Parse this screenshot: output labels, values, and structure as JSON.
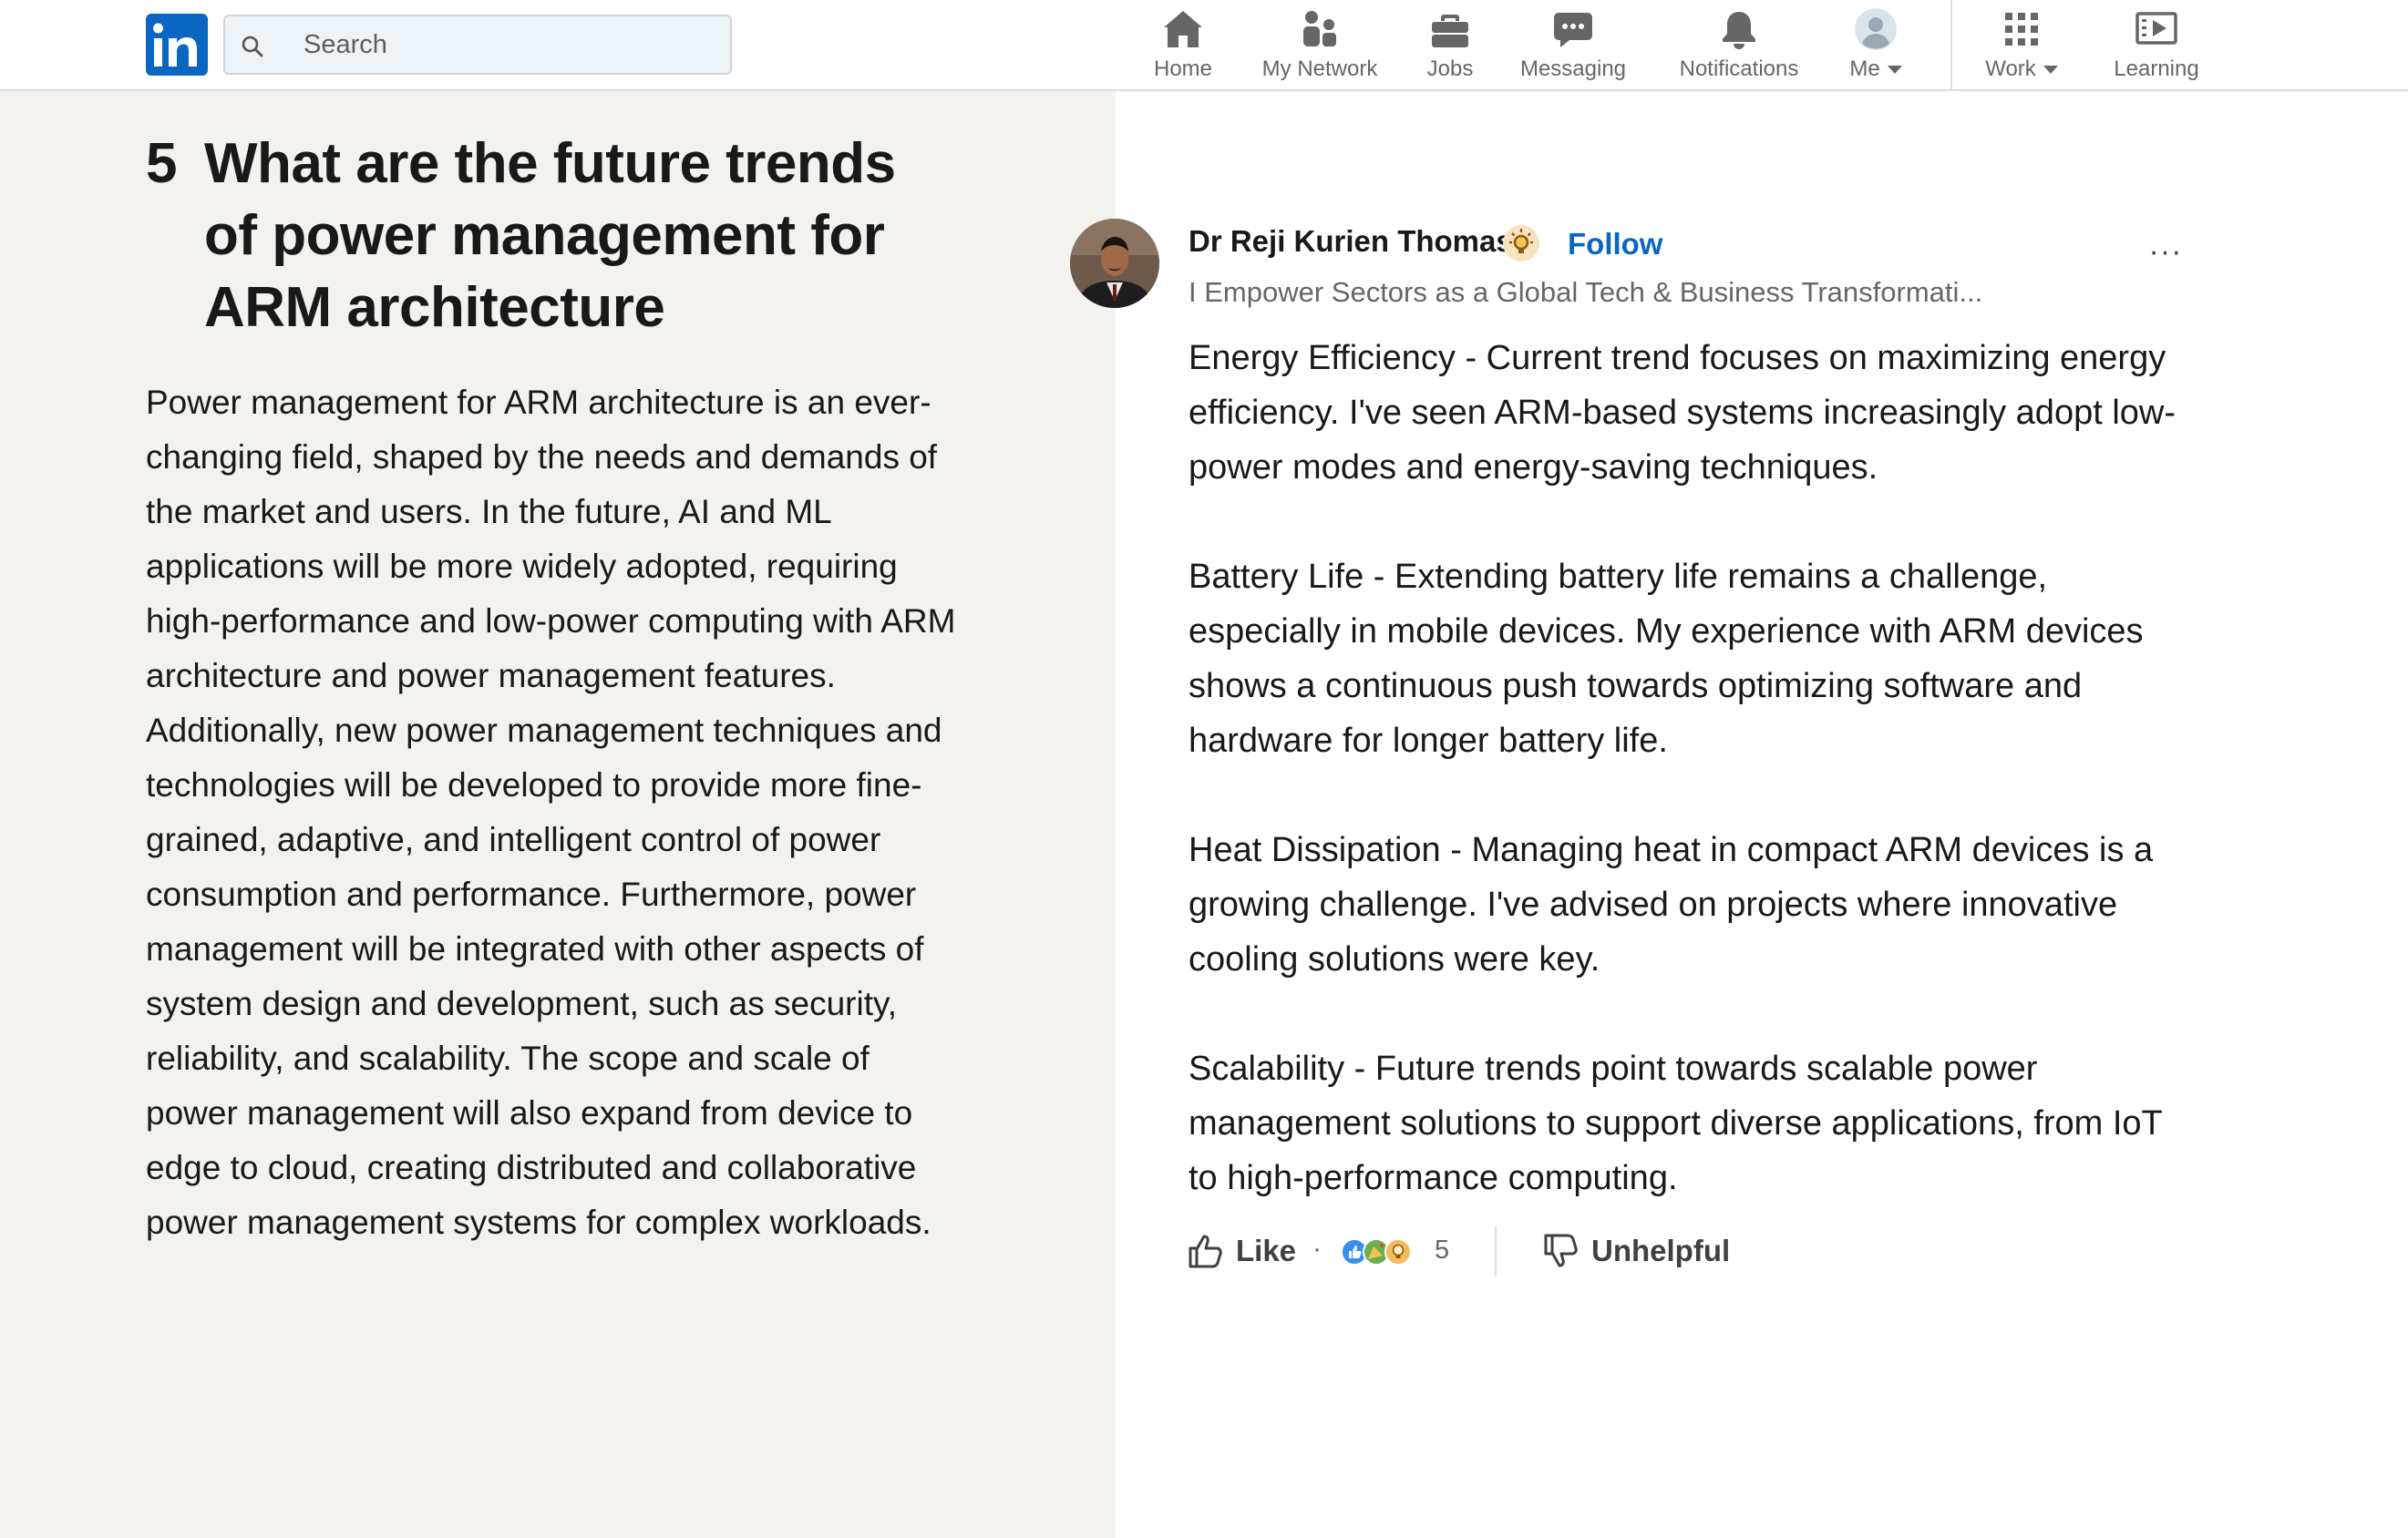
{
  "nav": {
    "search_placeholder": "Search",
    "items": [
      {
        "label": "Home",
        "icon": "home-icon"
      },
      {
        "label": "My Network",
        "icon": "my-network-icon"
      },
      {
        "label": "Jobs",
        "icon": "jobs-icon"
      },
      {
        "label": "Messaging",
        "icon": "messaging-icon"
      },
      {
        "label": "Notifications",
        "icon": "notifications-icon"
      },
      {
        "label": "Me",
        "icon": "profile-avatar-icon"
      },
      {
        "label": "Work",
        "icon": "grid-apps-icon"
      },
      {
        "label": "Learning",
        "icon": "learning-icon"
      }
    ]
  },
  "article": {
    "section_number": "5",
    "section_title": "What are the future trends of power management for ARM architecture",
    "section_body": "Power management for ARM architecture is an ever-changing field, shaped by the needs and demands of the market and users. In the future, AI and ML applications will be more widely adopted, requiring high-performance and low-power computing with ARM architecture and power management features. Additionally, new power management techniques and technologies will be developed to provide more fine-grained, adaptive, and intelligent control of power consumption and performance. Furthermore, power management will be integrated with other aspects of system design and development, such as security, reliability, and scalability. The scope and scale of power management will also expand from device to edge to cloud, creating distributed and collaborative power management systems for complex workloads."
  },
  "contribution": {
    "author_name": "Dr Reji Kurien Thomas",
    "follow_label": "Follow",
    "headline": "I Empower Sectors as a Global Tech & Business Transformati...",
    "overflow_label": "···",
    "paragraphs": [
      "Energy Efficiency - Current trend focuses on maximizing energy efficiency. I've seen ARM-based systems increasingly adopt low-power modes and energy-saving techniques.",
      "Battery Life - Extending battery life remains a challenge, especially in mobile devices. My experience with ARM devices shows a continuous push towards optimizing software and hardware for longer battery life.",
      "Heat Dissipation - Managing heat in compact ARM devices is a growing challenge. I've advised on projects where innovative cooling solutions were key.",
      "Scalability - Future trends point towards scalable power management solutions to support diverse applications, from IoT to high-performance computing."
    ],
    "like_label": "Like",
    "dot": "·",
    "reaction_count": "5",
    "unhelpful_label": "Unhelpful"
  },
  "colors": {
    "brand_blue": "#0a66c2",
    "left_pane_bg": "#f3f2ef",
    "text_primary": "#191919",
    "text_secondary": "#666666"
  }
}
